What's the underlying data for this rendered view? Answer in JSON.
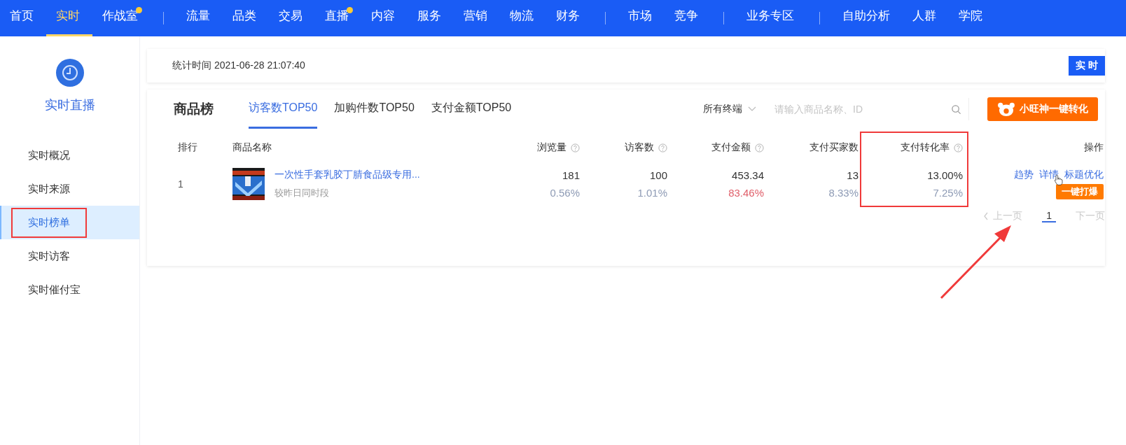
{
  "nav": {
    "groups": [
      {
        "items": [
          {
            "label": "首页",
            "selected": false,
            "dot": false
          },
          {
            "label": "实时",
            "selected": true,
            "dot": false
          },
          {
            "label": "作战室",
            "selected": false,
            "dot": true
          }
        ]
      },
      {
        "items": [
          {
            "label": "流量",
            "selected": false,
            "dot": false
          },
          {
            "label": "品类",
            "selected": false,
            "dot": false
          },
          {
            "label": "交易",
            "selected": false,
            "dot": false
          },
          {
            "label": "直播",
            "selected": false,
            "dot": true
          },
          {
            "label": "内容",
            "selected": false,
            "dot": false
          },
          {
            "label": "服务",
            "selected": false,
            "dot": false
          },
          {
            "label": "营销",
            "selected": false,
            "dot": false
          },
          {
            "label": "物流",
            "selected": false,
            "dot": false
          },
          {
            "label": "财务",
            "selected": false,
            "dot": false
          }
        ]
      },
      {
        "items": [
          {
            "label": "市场",
            "selected": false,
            "dot": false
          },
          {
            "label": "竞争",
            "selected": false,
            "dot": false
          }
        ]
      },
      {
        "items": [
          {
            "label": "业务专区",
            "selected": false,
            "dot": false
          }
        ]
      },
      {
        "items": [
          {
            "label": "自助分析",
            "selected": false,
            "dot": false
          },
          {
            "label": "人群",
            "selected": false,
            "dot": false
          },
          {
            "label": "学院",
            "selected": false,
            "dot": false
          }
        ]
      }
    ]
  },
  "sidebar": {
    "title": "实时直播",
    "items": [
      {
        "label": "实时概况",
        "selected": false,
        "marked": false
      },
      {
        "label": "实时来源",
        "selected": false,
        "marked": false
      },
      {
        "label": "实时榜单",
        "selected": true,
        "marked": true
      },
      {
        "label": "实时访客",
        "selected": false,
        "marked": false
      },
      {
        "label": "实时催付宝",
        "selected": false,
        "marked": false
      }
    ]
  },
  "stats_bar": {
    "time": "统计时间 2021-06-28 21:07:40",
    "button": "实 时"
  },
  "ranking": {
    "title": "商品榜",
    "tabs": [
      {
        "label": "访客数TOP50",
        "selected": true
      },
      {
        "label": "加购件数TOP50",
        "selected": false
      },
      {
        "label": "支付金额TOP50",
        "selected": false
      }
    ],
    "terminal_select": "所有终端",
    "search": {
      "placeholder": "请输入商品名称、ID"
    },
    "convert_button": "小旺神一键转化",
    "table": {
      "columns": [
        {
          "label": "排行",
          "help": false,
          "marked": false
        },
        {
          "label": "商品名称",
          "help": false,
          "marked": false
        },
        {
          "label": "浏览量",
          "help": true,
          "marked": false
        },
        {
          "label": "访客数",
          "help": true,
          "marked": false
        },
        {
          "label": "支付金额",
          "help": true,
          "marked": false
        },
        {
          "label": "支付买家数",
          "help": false,
          "marked": false
        },
        {
          "label": "支付转化率",
          "help": true,
          "marked": true
        },
        {
          "label": "操作",
          "help": false,
          "marked": false
        }
      ],
      "rows": [
        {
          "rank": "1",
          "product": {
            "title": "一次性手套乳胶丁腈食品级专用...",
            "subtitle": "较昨日同时段"
          },
          "metrics": [
            {
              "value": "181",
              "change": "0.56%",
              "color": "#8e9bb5"
            },
            {
              "value": "100",
              "change": "1.01%",
              "color": "#8e9bb5"
            },
            {
              "value": "453.34",
              "change": "83.46%",
              "color": "#e0606b"
            },
            {
              "value": "13",
              "change": "8.33%",
              "color": "#8e9bb5"
            },
            {
              "value": "13.00%",
              "change": "7.25%",
              "color": "#8e9bb5"
            }
          ],
          "actions": [
            "趋势",
            "详情",
            "标题优化"
          ],
          "boost_button": "一键打爆"
        }
      ]
    },
    "pagination": {
      "prev": "上一页",
      "pages": [
        {
          "label": "1",
          "selected": true
        }
      ],
      "next": "下一页"
    }
  }
}
